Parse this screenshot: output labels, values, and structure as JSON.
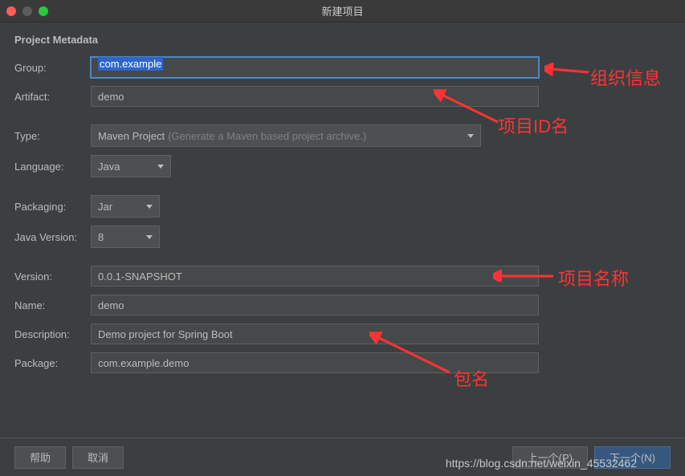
{
  "window": {
    "title": "新建项目"
  },
  "section": {
    "header": "Project Metadata"
  },
  "labels": {
    "group": "Group:",
    "artifact": "Artifact:",
    "type": "Type:",
    "language": "Language:",
    "packaging": "Packaging:",
    "javaVersion": "Java Version:",
    "version": "Version:",
    "name": "Name:",
    "description": "Description:",
    "package": "Package:"
  },
  "values": {
    "group": "com.example",
    "artifact": "demo",
    "type": "Maven Project",
    "typeHint": "(Generate a Maven based project archive.)",
    "language": "Java",
    "packaging": "Jar",
    "javaVersion": "8",
    "version": "0.0.1-SNAPSHOT",
    "name": "demo",
    "description": "Demo project for Spring Boot",
    "package": "com.example.demo"
  },
  "buttons": {
    "help": "帮助",
    "cancel": "取消",
    "previous": "上一个(P)",
    "next": "下一个(N)"
  },
  "annotations": {
    "orgInfo": "组织信息",
    "projectId": "项目ID名",
    "projectName": "项目名称",
    "packageName": "包名"
  },
  "watermark": "https://blog.csdn.net/weixin_45532462"
}
